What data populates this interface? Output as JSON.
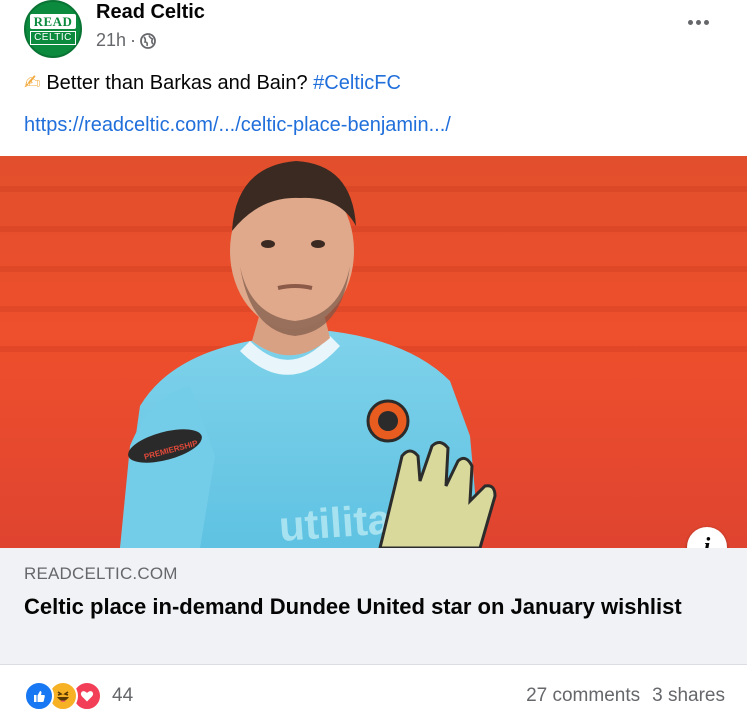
{
  "header": {
    "avatar_top": "READ",
    "avatar_bottom": "CELTIC",
    "page_name": "Read Celtic",
    "timestamp": "21h",
    "separator": "·"
  },
  "post": {
    "emoji": "✍",
    "text": "Better than Barkas and Bain?",
    "hashtag": "#CelticFC",
    "link": "https://readceltic.com/.../celtic-place-benjamin.../"
  },
  "link_card": {
    "domain": "READCELTIC.COM",
    "title": "Celtic place in-demand Dundee United star on January wishlist",
    "info_glyph": "i"
  },
  "footer": {
    "reaction_count": "44",
    "comments": "27 comments",
    "shares": "3 shares"
  },
  "image_text": {
    "sponsor": "utilita",
    "sleeve_patch": "PREMIERSHIP"
  },
  "colors": {
    "link_blue": "#216fdb",
    "brand_green": "#0c8a3e",
    "like_blue": "#1877f2",
    "haha_yellow": "#f7b125",
    "love_red": "#f33e58"
  },
  "icons": [
    "globe-icon",
    "more-options-icon",
    "like-reaction-icon",
    "haha-reaction-icon",
    "love-reaction-icon",
    "info-icon"
  ]
}
